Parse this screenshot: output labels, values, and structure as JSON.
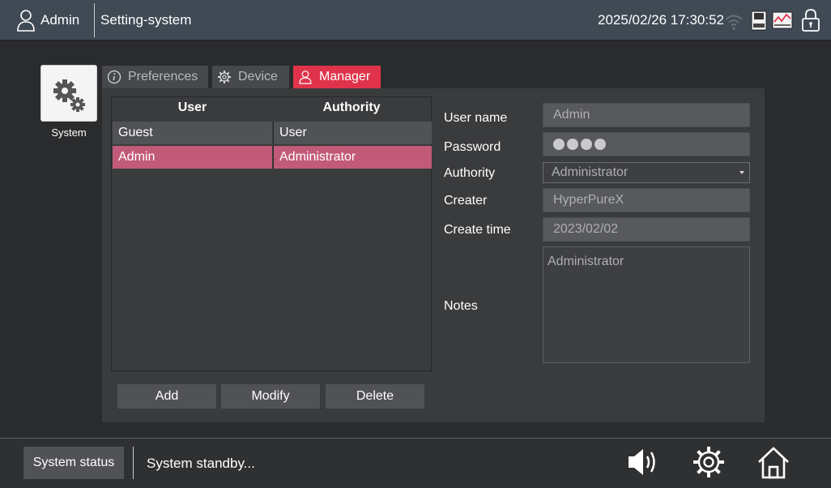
{
  "header": {
    "user": "Admin",
    "title": "Setting-system",
    "datetime": "2025/02/26 17:30:52",
    "icons": [
      "user-icon",
      "wifi-icon",
      "usb-icon",
      "monitor-chart-icon",
      "lock-icon"
    ]
  },
  "sidebar": {
    "tile_label": "System",
    "tile_icon": "gears-icon"
  },
  "tabs": [
    {
      "label": "Preferences",
      "icon": "info-icon",
      "active": false
    },
    {
      "label": "Device",
      "icon": "gear-icon",
      "active": false
    },
    {
      "label": "Manager",
      "icon": "user-icon",
      "active": true
    }
  ],
  "table": {
    "headers": [
      "User",
      "Authority"
    ],
    "rows": [
      {
        "user": "Guest",
        "authority": "User",
        "selected": false
      },
      {
        "user": "Admin",
        "authority": "Administrator",
        "selected": true
      }
    ]
  },
  "actions": {
    "add": "Add",
    "modify": "Modify",
    "delete": "Delete"
  },
  "form": {
    "user_name_label": "User name",
    "user_name_value": "Admin",
    "password_label": "Password",
    "authority_label": "Authority",
    "authority_value": "Administrator",
    "creater_label": "Creater",
    "creater_value": "HyperPureX",
    "create_time_label": "Create time",
    "create_time_value": "2023/02/02",
    "notes_label": "Notes",
    "notes_value": "Administrator"
  },
  "footer": {
    "status_button": "System status",
    "status_text": "System standby...",
    "icons": [
      "speaker-icon",
      "settings-gear-icon",
      "home-icon"
    ]
  },
  "colors": {
    "accent": "#e0334b",
    "selected_row": "#c25a7a",
    "header_bg": "#3f4a55"
  }
}
